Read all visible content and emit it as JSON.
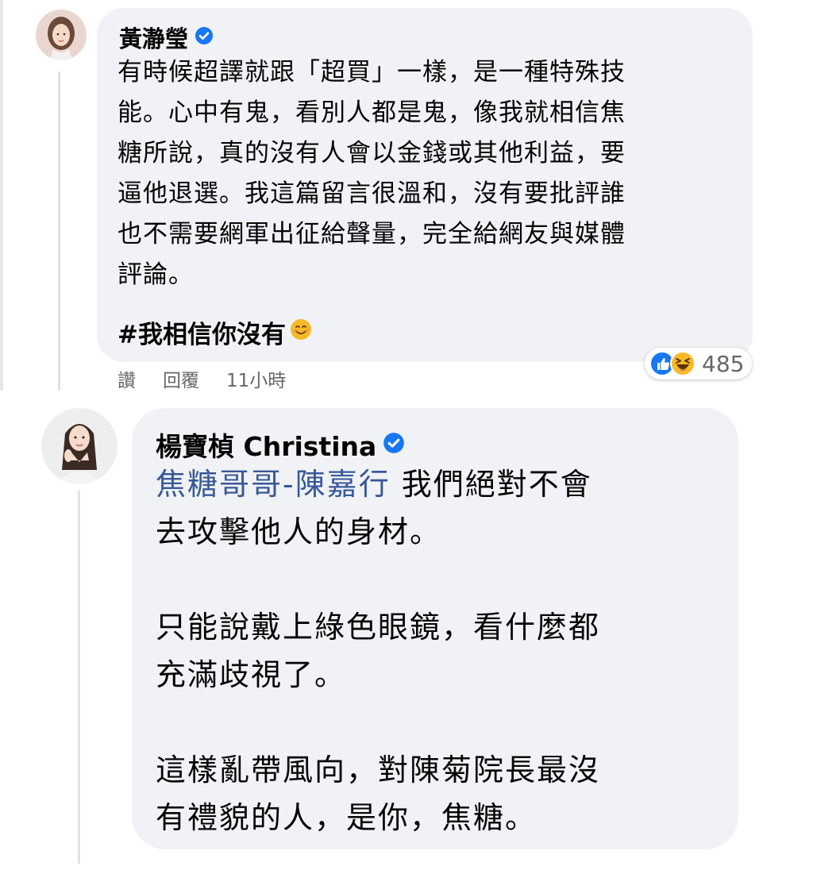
{
  "comment1": {
    "author": "黃瀞瑩",
    "verified_icon": "verified-badge-icon",
    "body_lines": [
      "有時候超譯就跟「超買」一樣，是一種特殊技",
      "能。心中有鬼，看別人都是鬼，像我就相信焦",
      "糖所說，真的沒有人會以金錢或其他利益，要",
      "逼他退選。我這篇留言很溫和，沒有要批評誰",
      "也不需要網軍出征給聲量，完全給網友與媒體",
      "評論。"
    ],
    "hashtag": "#我相信你沒有",
    "hashtag_emoji": "smiling-face-icon",
    "actions": {
      "like": "讚",
      "reply": "回覆",
      "time": "11小時"
    },
    "reactions": {
      "icons": [
        "like-reaction-icon",
        "haha-reaction-icon"
      ],
      "count": "485"
    },
    "colors": {
      "bubble": "#f0f2f5",
      "verified": "#1877f2",
      "meta": "#65676b"
    }
  },
  "comment2": {
    "author": "楊寶楨 Christina",
    "verified_icon": "verified-badge-icon",
    "mention": "焦糖哥哥-陳嘉行",
    "line1_rest": " 我們絕對不會",
    "lines": [
      "去攻擊他人的身材。",
      "",
      "只能說戴上綠色眼鏡，看什麼都",
      "充滿歧視了。",
      "",
      "這樣亂帶風向，對陳菊院長最沒",
      "有禮貌的人，是你，焦糖。"
    ],
    "colors": {
      "mention": "#385898"
    }
  }
}
